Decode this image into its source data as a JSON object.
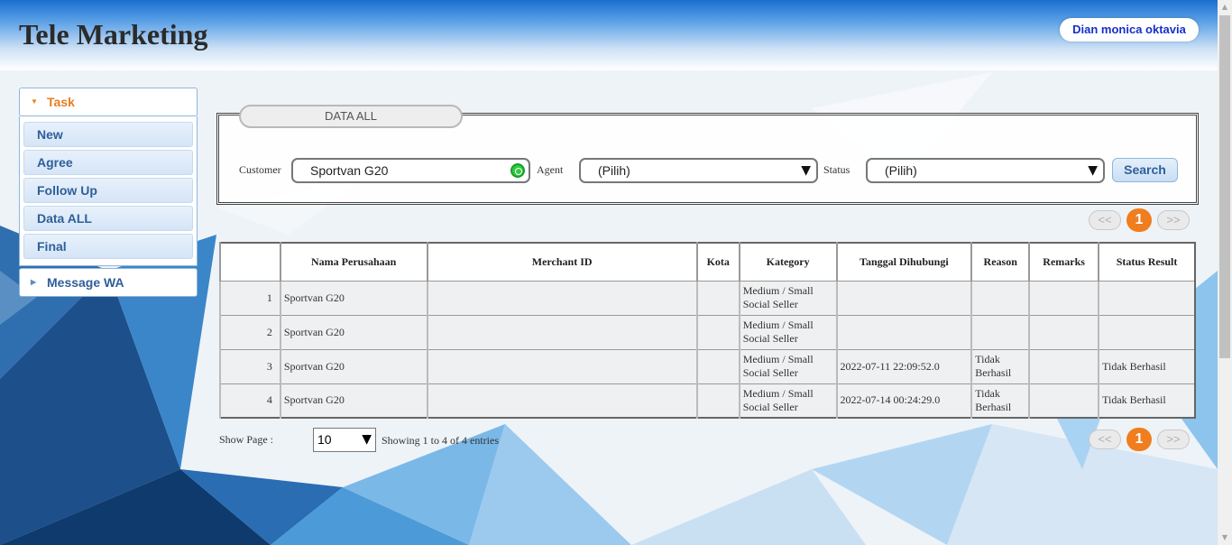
{
  "header": {
    "app_title": "Tele Marketing",
    "user_name": "Dian monica oktavia"
  },
  "sidebar": {
    "task_label": "Task",
    "items": [
      {
        "label": "New"
      },
      {
        "label": "Agree"
      },
      {
        "label": "Follow Up"
      },
      {
        "label": "Data ALL"
      },
      {
        "label": "Final"
      }
    ],
    "message_wa_label": "Message WA"
  },
  "filter": {
    "panel_title": "DATA ALL",
    "customer_label": "Customer",
    "customer_value": "Sportvan G20",
    "agent_label": "Agent",
    "agent_value": "(Pilih)",
    "status_label": "Status",
    "status_value": "(Pilih)",
    "search_label": "Search"
  },
  "pagination": {
    "prev": "<<",
    "current": "1",
    "next": ">>"
  },
  "table": {
    "headers": [
      "",
      "Nama Perusahaan",
      "Merchant ID",
      "Kota",
      "Kategory",
      "Tanggal Dihubungi",
      "Reason",
      "Remarks",
      "Status Result"
    ],
    "rows": [
      {
        "no": "1",
        "nama": "Sportvan G20",
        "merchant": "",
        "kota": "",
        "kategory": "Medium / Small Social Seller",
        "tanggal": "",
        "reason": "",
        "remarks": "",
        "status": ""
      },
      {
        "no": "2",
        "nama": "Sportvan G20",
        "merchant": "",
        "kota": "",
        "kategory": "Medium / Small Social Seller",
        "tanggal": "",
        "reason": "",
        "remarks": "",
        "status": ""
      },
      {
        "no": "3",
        "nama": "Sportvan G20",
        "merchant": "",
        "kota": "",
        "kategory": "Medium / Small Social Seller",
        "tanggal": "2022-07-11 22:09:52.0",
        "reason": "Tidak Berhasil",
        "remarks": "",
        "status": "Tidak Berhasil"
      },
      {
        "no": "4",
        "nama": "Sportvan G20",
        "merchant": "",
        "kota": "",
        "kategory": "Medium / Small Social Seller",
        "tanggal": "2022-07-14 00:24:29.0",
        "reason": "Tidak Berhasil",
        "remarks": "",
        "status": "Tidak Berhasil"
      }
    ]
  },
  "footer": {
    "show_page_label": "Show Page :",
    "page_size": "10",
    "showing_text": "Showing 1 to 4 of 4 entries"
  },
  "colors": {
    "accent_orange": "#f07d1e",
    "header_blue": "#1b6fd0",
    "link_blue": "#1530c8"
  }
}
